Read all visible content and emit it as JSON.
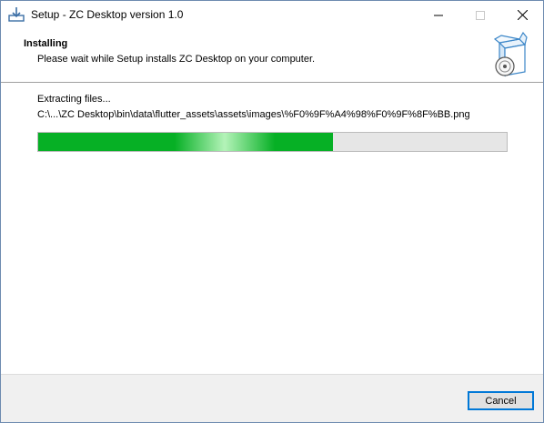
{
  "window": {
    "title": "Setup - ZC Desktop version 1.0",
    "icon": "setup-download-icon"
  },
  "header": {
    "title": "Installing",
    "subtitle": "Please wait while Setup installs ZC Desktop on your computer.",
    "icon": "software-box-cd-icon"
  },
  "main": {
    "status": "Extracting files...",
    "current_file": "C:\\...\\ZC Desktop\\bin\\data\\flutter_assets\\assets\\images\\%F0%9F%A4%98%F0%9F%8F%BB.png",
    "progress_percent": 63,
    "progress_color": "#06b025"
  },
  "footer": {
    "cancel_label": "Cancel"
  }
}
